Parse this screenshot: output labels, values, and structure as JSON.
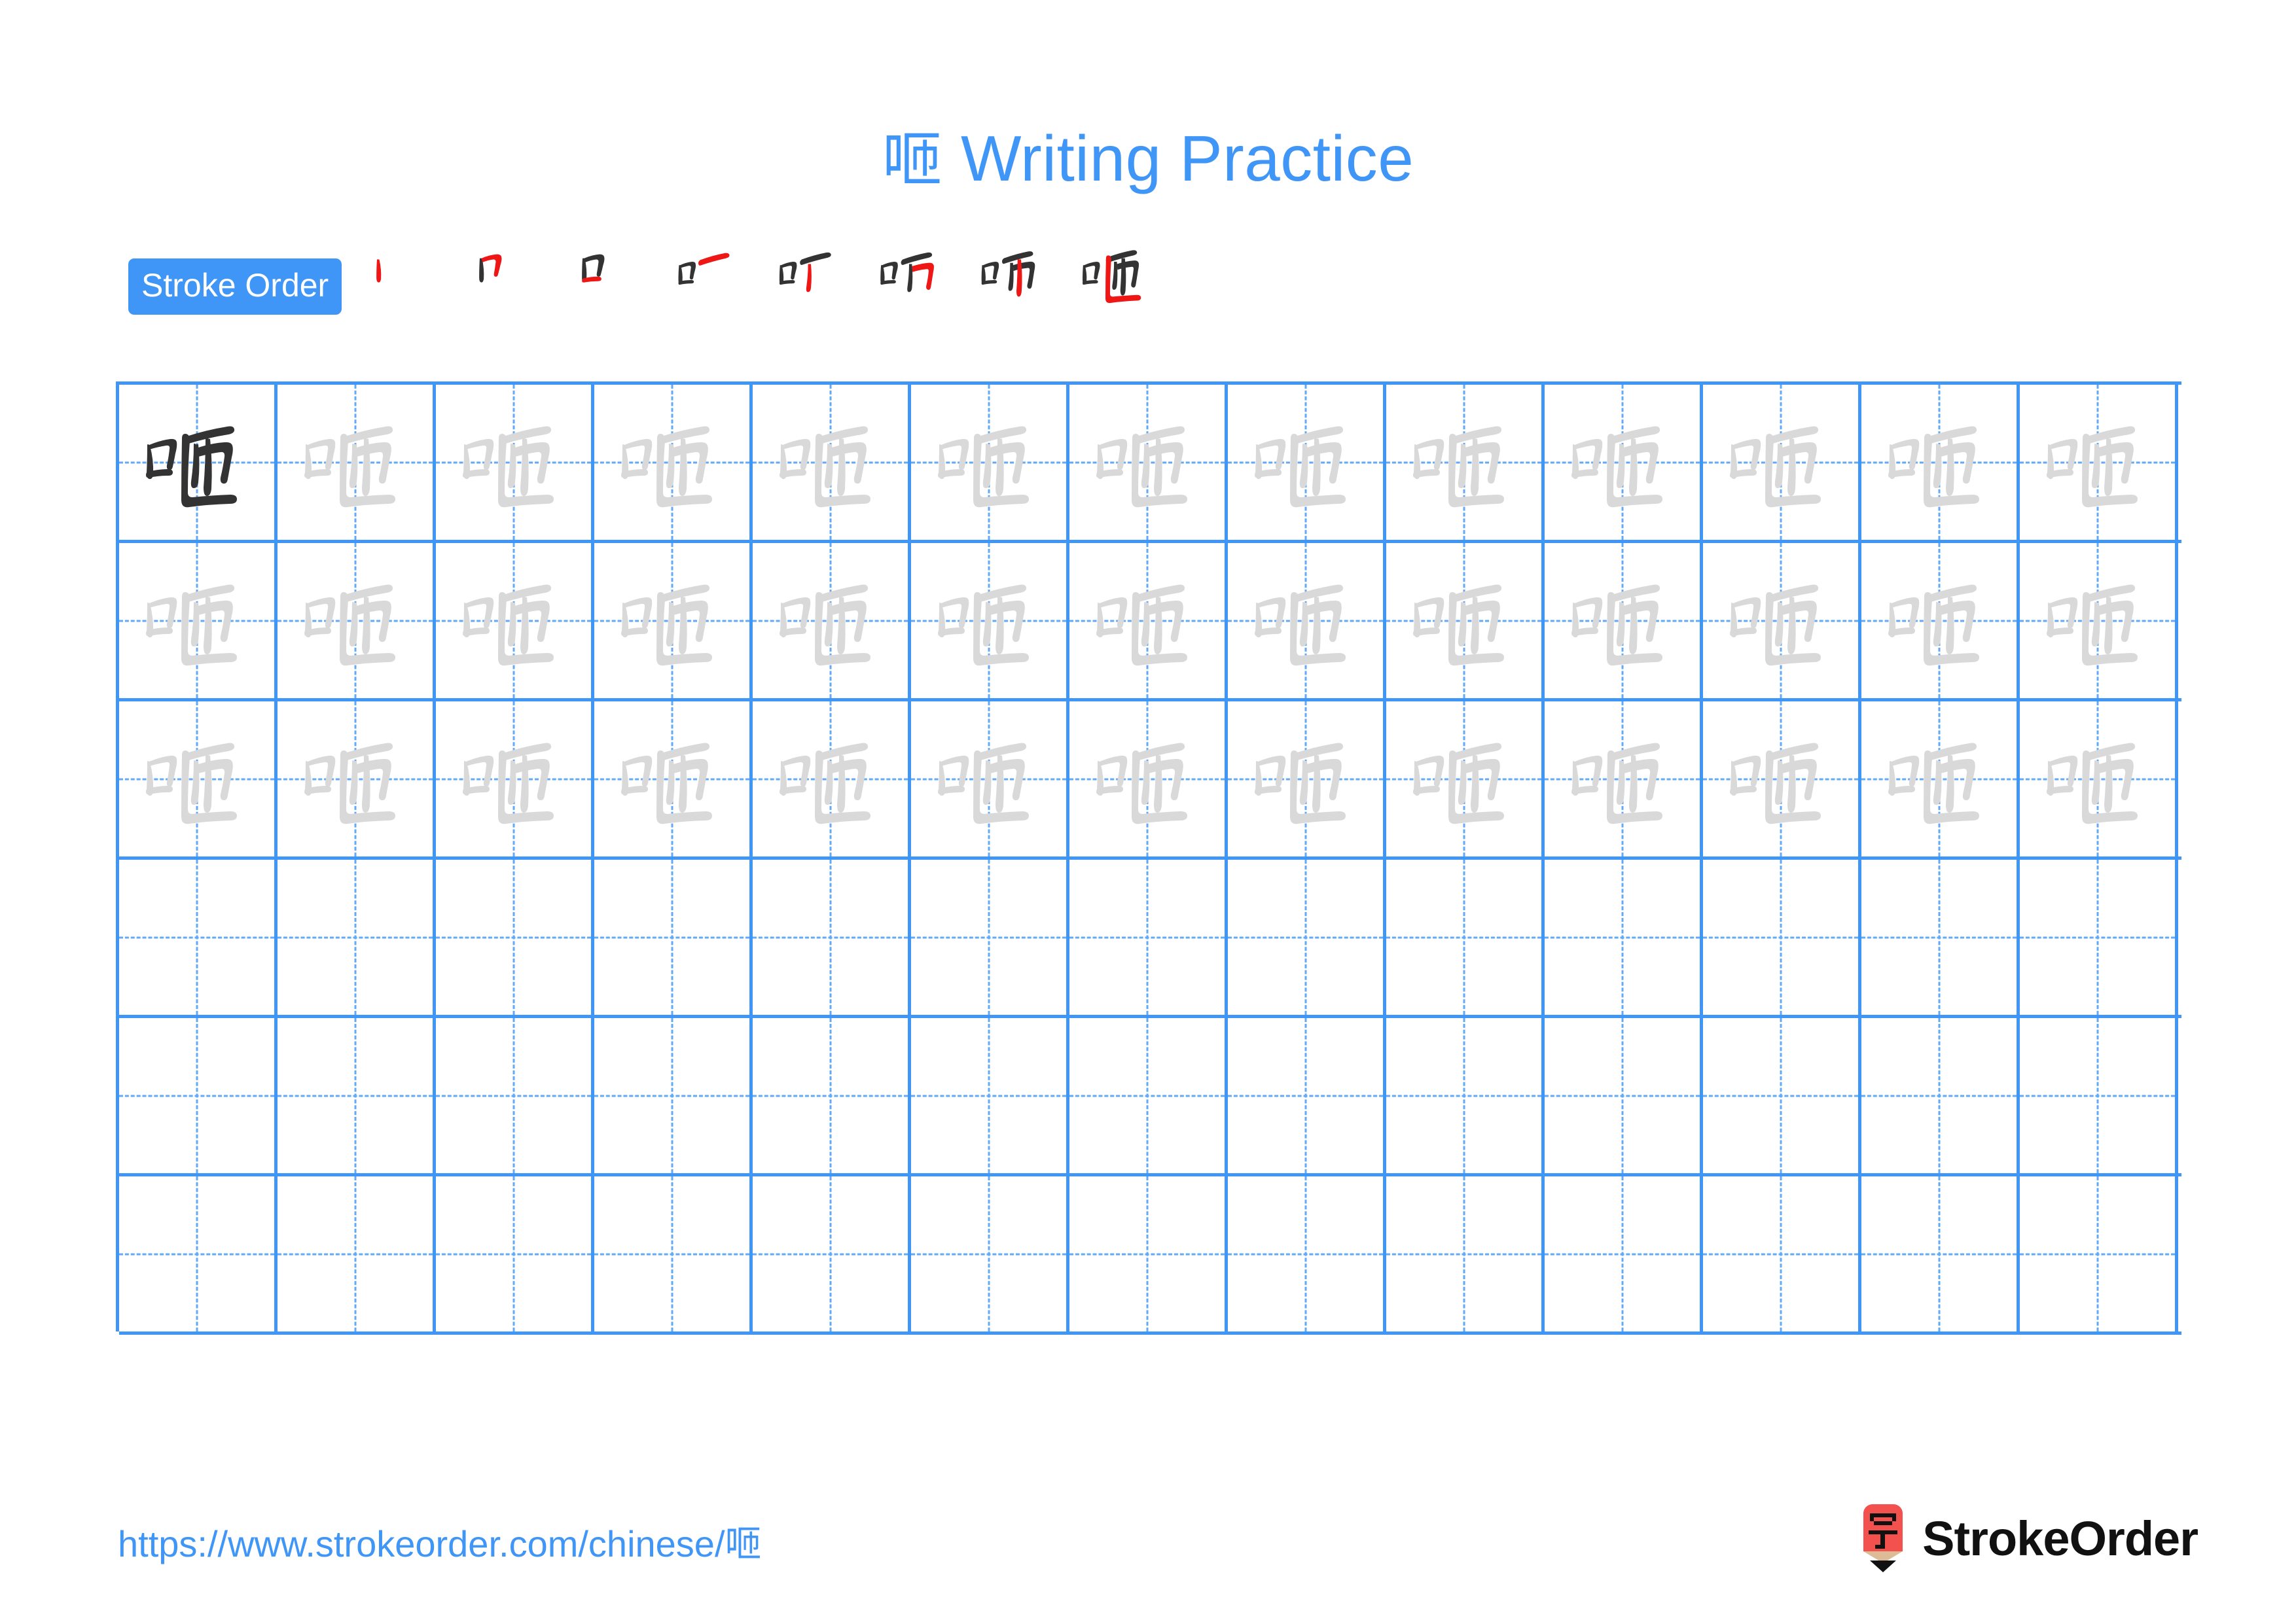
{
  "page": {
    "character": "咂",
    "title_suffix": "Writing Practice",
    "background_color": "#ffffff",
    "accent_color": "#4096f7",
    "guide_color": "#62a9f7",
    "trace_color": "#d9d9d9",
    "ink_color": "#333333",
    "new_stroke_color": "#ef1616"
  },
  "stroke_order": {
    "badge_label": "Stroke Order",
    "total_strokes": 8,
    "steps": [
      {
        "index": 1,
        "strokes_done": 0,
        "new_stroke": "shu (vertical left of mouth)"
      },
      {
        "index": 2,
        "strokes_done": 1,
        "new_stroke": "heng-zhe (top + right of mouth)"
      },
      {
        "index": 3,
        "strokes_done": 2,
        "new_stroke": "heng (bottom of mouth)"
      },
      {
        "index": 4,
        "strokes_done": 3,
        "new_stroke": "heng (top horizontal of za)"
      },
      {
        "index": 5,
        "strokes_done": 4,
        "new_stroke": "pie (left downward)"
      },
      {
        "index": 6,
        "strokes_done": 5,
        "new_stroke": "heng-zhe-gou (box of jin)"
      },
      {
        "index": 7,
        "strokes_done": 6,
        "new_stroke": "shu (center vertical)"
      },
      {
        "index": 8,
        "strokes_done": 7,
        "new_stroke": "shu-zhe (enclosing hook)"
      }
    ]
  },
  "practice_grid": {
    "columns": 13,
    "rows": 6,
    "filled_rows": 3,
    "empty_rows": 3,
    "first_cell_is_ink": true,
    "cell_size_px": 242
  },
  "footer": {
    "url_prefix": "https://www.strokeorder.com/chinese/",
    "url_character": "咂",
    "brand_name": "StrokeOrder",
    "logo_icon": "pencil-logo-icon",
    "logo_character": "字",
    "logo_color": "#f2514e",
    "logo_wood_color": "#dcbb96"
  }
}
